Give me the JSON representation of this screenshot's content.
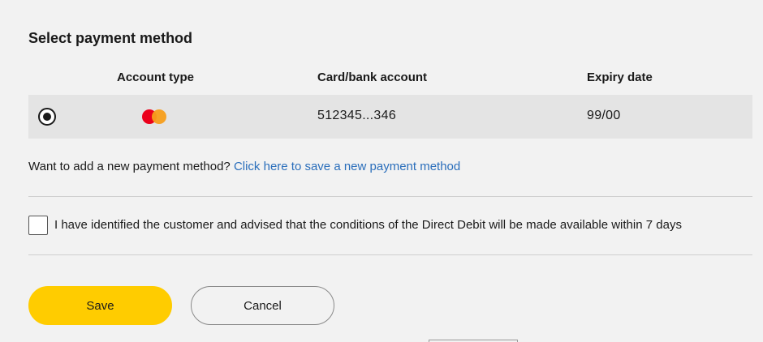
{
  "section": {
    "title": "Select payment method"
  },
  "table": {
    "headers": {
      "account_type": "Account type",
      "card_bank_account": "Card/bank account",
      "expiry_date": "Expiry date"
    },
    "rows": [
      {
        "selected": true,
        "account_type_icon": "mastercard-logo",
        "card_bank_account": "512345...346",
        "expiry_date": "99/00"
      }
    ]
  },
  "add_method": {
    "prompt": "Want to add a new payment method?",
    "link_text": "Click here to save a new payment method"
  },
  "consent": {
    "checked": false,
    "label": "I have identified the customer and advised that the conditions of the Direct Debit will be made available within 7 days"
  },
  "actions": {
    "save_label": "Save",
    "cancel_label": "Cancel"
  },
  "colors": {
    "background": "#f2f2f2",
    "selected_row": "#e4e4e4",
    "save_button": "#ffcc00",
    "link": "#2a6ebb",
    "mastercard_red": "#eb001b",
    "mastercard_orange": "#f79e1b"
  }
}
